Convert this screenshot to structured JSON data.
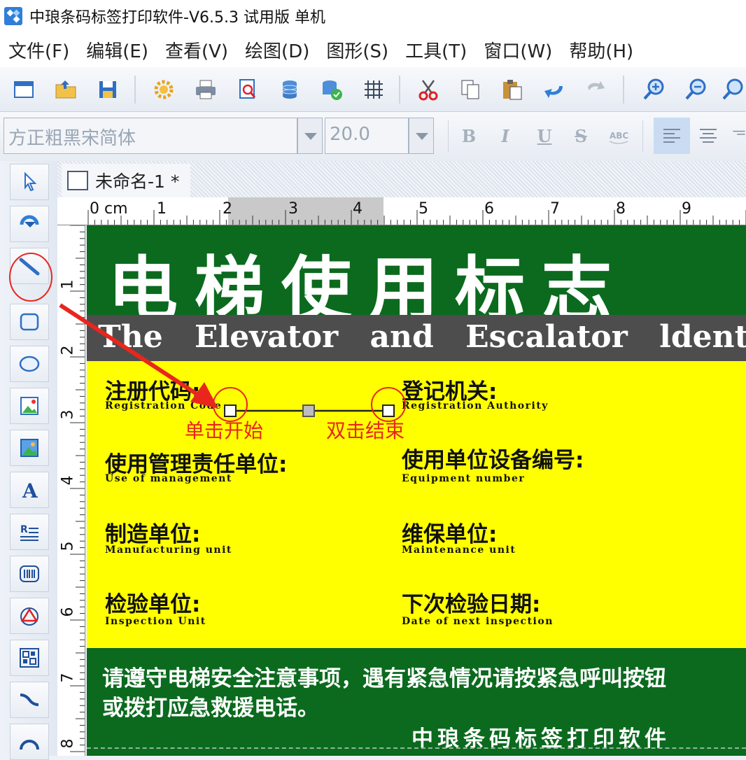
{
  "window": {
    "title": "中琅条码标签打印软件-V6.5.3 试用版 单机"
  },
  "menu": [
    "文件(F)",
    "编辑(E)",
    "查看(V)",
    "绘图(D)",
    "图形(S)",
    "工具(T)",
    "窗口(W)",
    "帮助(H)"
  ],
  "fontbar": {
    "font_value": "方正粗黑宋简体",
    "size_value": "20.0",
    "format_buttons": [
      "B",
      "I",
      "U",
      "S"
    ]
  },
  "document": {
    "tab_label": "未命名-1 *"
  },
  "rulers": {
    "horizontal": [
      "0 cm",
      "1",
      "2",
      "3",
      "4",
      "5",
      "6",
      "7",
      "8",
      "9"
    ],
    "vertical": [
      "1",
      "2",
      "3",
      "4",
      "5",
      "6",
      "7",
      "8"
    ]
  },
  "label": {
    "main_title": "电梯使用标志",
    "english_title": "The Elevator and Escalator ldentification",
    "fields": [
      {
        "cn": "注册代码:",
        "en": "Registration Code"
      },
      {
        "cn": "登记机关:",
        "en": "Registration Authority"
      },
      {
        "cn": "使用管理责任单位:",
        "en": "Use of management"
      },
      {
        "cn": "使用单位设备编号:",
        "en": "Equipment number"
      },
      {
        "cn": "制造单位:",
        "en": "Manufacturing unit"
      },
      {
        "cn": "维保单位:",
        "en": "Maintenance unit"
      },
      {
        "cn": "检验单位:",
        "en": "Inspection Unit"
      },
      {
        "cn": "下次检验日期:",
        "en": "Date of next inspection"
      }
    ],
    "notice_line1": "请遵守电梯安全注意事项，遇有紧急情况请按紧急呼叫按钮",
    "notice_line2": "或拨打应急救援电话。",
    "footer_brand": "中琅条码标签打印软件"
  },
  "annotations": {
    "start": "单击开始",
    "end": "双击结束"
  },
  "colors": {
    "label_green": "#0b6a1e",
    "label_yellow": "#ffff00",
    "band_grey": "#4d4d4d",
    "annotation_red": "#e8261e"
  },
  "toolbar_icons": [
    "new-icon",
    "open-icon",
    "save-icon",
    "settings-icon",
    "print-icon",
    "print-preview-icon",
    "database-icon",
    "database-settings-icon",
    "grid-icon",
    "cut-icon",
    "copy-icon",
    "paste-icon",
    "undo-icon",
    "redo-icon",
    "zoom-in-icon",
    "zoom-out-icon",
    "zoom-icon"
  ],
  "left_tools": [
    "select-tool",
    "rotate-tool",
    "line-tool",
    "rectangle-tool",
    "ellipse-tool",
    "image-tool",
    "picture-tool",
    "text-tool",
    "rich-text-tool",
    "barcode-tool",
    "shape-tool",
    "qrcode-tool",
    "curve-tool",
    "arc-tool"
  ]
}
